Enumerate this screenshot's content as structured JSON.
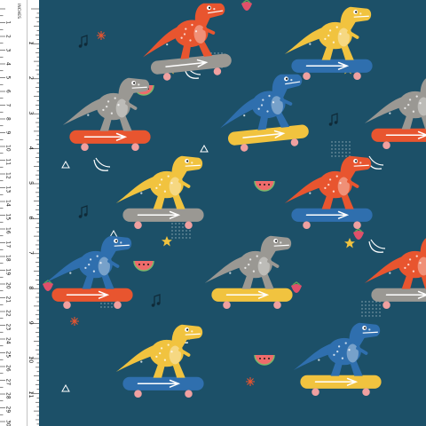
{
  "ruler": {
    "unit_label": "INCHES",
    "cm_labels": [
      "1",
      "2",
      "3",
      "4",
      "5",
      "6",
      "7",
      "8",
      "9",
      "10",
      "11",
      "12",
      "13",
      "14",
      "15",
      "16",
      "17",
      "18",
      "19",
      "20",
      "21",
      "22",
      "23",
      "24",
      "25",
      "26",
      "27",
      "28",
      "29",
      "30"
    ],
    "inch_labels": [
      "1",
      "2",
      "3",
      "4",
      "5",
      "6",
      "7",
      "8",
      "9",
      "10",
      "11",
      "12"
    ]
  },
  "fabric": {
    "pattern": "skateboarding dinosaurs",
    "background_color": "#1c5068",
    "palette": {
      "orange": "#e8552f",
      "blue": "#2f6fae",
      "gray": "#9a9893",
      "yellow": "#f1c33f",
      "watermelon": "#ef6b6b",
      "strawberry": "#e0506a",
      "star": "#f1c33f",
      "sparkle": "#e8552f"
    },
    "motifs": [
      {
        "kind": "dino-skateboard",
        "dino": "orange",
        "board": "gray"
      },
      {
        "kind": "dino-skateboard",
        "dino": "yellow",
        "board": "blue"
      },
      {
        "kind": "dino-skateboard",
        "dino": "gray",
        "board": "orange"
      },
      {
        "kind": "dino-skateboard",
        "dino": "blue",
        "board": "yellow"
      },
      {
        "kind": "dino-skateboard",
        "dino": "yellow",
        "board": "gray"
      },
      {
        "kind": "dino-skateboard",
        "dino": "orange",
        "board": "blue"
      },
      {
        "kind": "dino-skateboard",
        "dino": "blue",
        "board": "orange"
      },
      {
        "kind": "dino-skateboard",
        "dino": "gray",
        "board": "yellow"
      },
      {
        "kind": "dino-skateboard",
        "dino": "orange",
        "board": "gray"
      },
      {
        "kind": "dino-skateboard",
        "dino": "yellow",
        "board": "blue"
      }
    ],
    "accent_icons": [
      "watermelon-slice-icon",
      "strawberry-icon",
      "banana-icon",
      "star-icon",
      "music-note-icon",
      "triangle-icon",
      "sparkle-icon",
      "dot-grid-icon"
    ]
  }
}
